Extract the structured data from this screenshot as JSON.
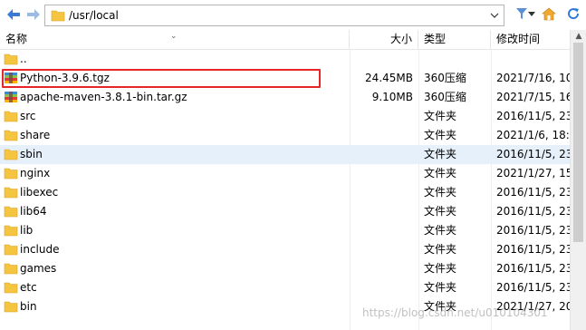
{
  "toolbar": {
    "path": "/usr/local",
    "back_icon": "left-arrow-icon",
    "forward_icon": "right-arrow-icon"
  },
  "columns": {
    "name": "名称",
    "size": "大小",
    "type": "类型",
    "modified": "修改时间"
  },
  "files": [
    {
      "name": "..",
      "size": "",
      "type": "",
      "modified": "",
      "icon": "folder-up"
    },
    {
      "name": "Python-3.9.6.tgz",
      "size": "24.45MB",
      "type": "360压缩",
      "modified": "2021/7/16, 10",
      "icon": "archive"
    },
    {
      "name": "apache-maven-3.8.1-bin.tar.gz",
      "size": "9.10MB",
      "type": "360压缩",
      "modified": "2021/7/15, 16",
      "icon": "archive"
    },
    {
      "name": "src",
      "size": "",
      "type": "文件夹",
      "modified": "2016/11/5, 23",
      "icon": "folder"
    },
    {
      "name": "share",
      "size": "",
      "type": "文件夹",
      "modified": "2021/1/6, 18:5",
      "icon": "folder"
    },
    {
      "name": "sbin",
      "size": "",
      "type": "文件夹",
      "modified": "2016/11/5, 23",
      "icon": "folder",
      "selected": true
    },
    {
      "name": "nginx",
      "size": "",
      "type": "文件夹",
      "modified": "2021/1/27, 15",
      "icon": "folder"
    },
    {
      "name": "libexec",
      "size": "",
      "type": "文件夹",
      "modified": "2016/11/5, 23",
      "icon": "folder"
    },
    {
      "name": "lib64",
      "size": "",
      "type": "文件夹",
      "modified": "2016/11/5, 23",
      "icon": "folder"
    },
    {
      "name": "lib",
      "size": "",
      "type": "文件夹",
      "modified": "2016/11/5, 23",
      "icon": "folder"
    },
    {
      "name": "include",
      "size": "",
      "type": "文件夹",
      "modified": "2016/11/5, 23",
      "icon": "folder"
    },
    {
      "name": "games",
      "size": "",
      "type": "文件夹",
      "modified": "2016/11/5, 23",
      "icon": "folder"
    },
    {
      "name": "etc",
      "size": "",
      "type": "文件夹",
      "modified": "2016/11/5, 23",
      "icon": "folder"
    },
    {
      "name": "bin",
      "size": "",
      "type": "文件夹",
      "modified": "2021/1/27, 20",
      "icon": "folder"
    }
  ],
  "watermark": "https://blog.csdn.net/u010104301",
  "colors": {
    "highlight": "#e8262a",
    "selected_row": "#e6f0fa",
    "folder": "#f5c542",
    "nav_arrow": "#3a7bd5"
  }
}
